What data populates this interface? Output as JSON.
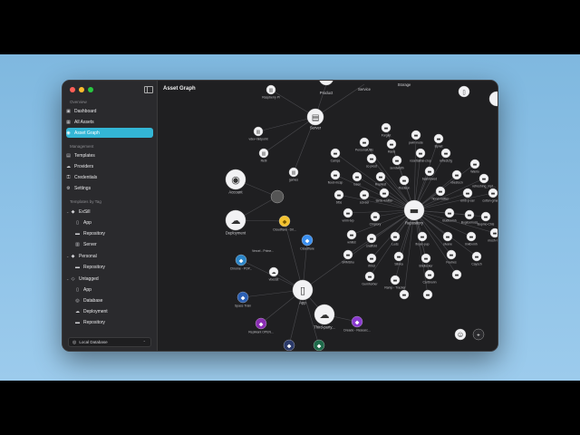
{
  "window": {
    "title": "Asset Graph"
  },
  "sidebar": {
    "sections": {
      "overview": "Overview",
      "management": "Management",
      "tags": "Templates by Tag"
    },
    "overview_items": [
      {
        "label": "Dashboard",
        "icon": "dashboard-icon"
      },
      {
        "label": "All Assets",
        "icon": "grid-icon"
      },
      {
        "label": "Asset Graph",
        "icon": "graph-icon",
        "active": true
      }
    ],
    "management_items": [
      {
        "label": "Templates",
        "icon": "template-icon"
      },
      {
        "label": "Providers",
        "icon": "cloud-icon"
      },
      {
        "label": "Credentials",
        "icon": "key-icon"
      },
      {
        "label": "Settings",
        "icon": "gear-icon"
      }
    ],
    "tag_groups": [
      {
        "label": "ExSill",
        "children": [
          "App",
          "Repository",
          "Server"
        ]
      },
      {
        "label": "Personal",
        "children": [
          "Repository"
        ]
      },
      {
        "label": "Untagged",
        "children": [
          "App",
          "Database",
          "Deployment",
          "Repository"
        ]
      }
    ],
    "footer": {
      "label": "Local Database"
    }
  },
  "graph": {
    "hub_labels": {
      "server": "Server",
      "account": "Account",
      "deployment": "Deployment",
      "app": "App",
      "repository": "Repository",
      "third_party": "Third-party...",
      "product": "Product",
      "storage": "Storage",
      "service": "Service"
    },
    "node_labels": [
      "Raspberry Pi",
      "vdev-midpoint",
      "Retil",
      "games",
      "Cloudflare - Dri...",
      "Cloudflare",
      "Vercel - Prime...",
      "Chrome - POP...",
      "vbestst",
      "Space Train",
      "Replikant OPEN...",
      "Dreade - Researc...",
      "Forglet",
      "PersonalUtils",
      "Rand",
      "pwm-node",
      "Bpnet",
      "Camps",
      "sc-prest",
      "sendwidth",
      "rosettatrial-crop",
      "reflectcfg",
      "Wanlo",
      "refreshing_mpt...",
      "flood-mcsp",
      "rosen",
      "Repliest",
      "Rosteon",
      "basinloved",
      "vbestocn",
      "bfbs",
      "sclvsel",
      "tarde-whitter",
      "hbnm-twitter",
      "emb-p-ser",
      "cotton-gmatsun",
      "vmm-tvp",
      "Chiptory",
      "Budloomh",
      "Buglcemoss",
      "Bupmo-Chis",
      "whilist",
      "snaffold",
      "Luds",
      "finyer-pup",
      "slvane",
      "linkbvmh",
      "mosh-rum",
      "SRMShu",
      "ifrind",
      "Slinka",
      "Bndlocker",
      "Fouhes",
      "Caysch",
      "Gumhorber",
      "Ramp - Tracker",
      "Cartbrunn"
    ]
  }
}
